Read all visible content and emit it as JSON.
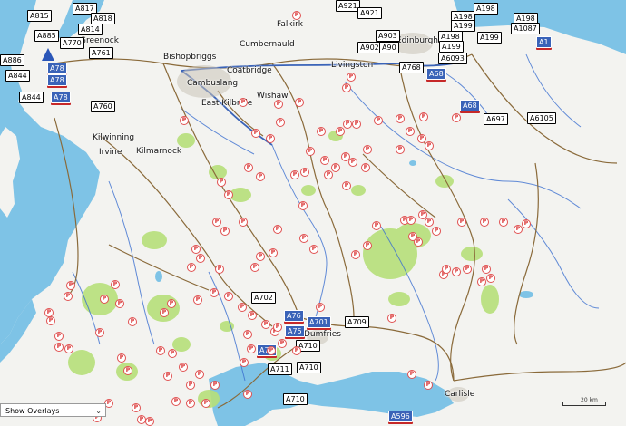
{
  "map": {
    "colors": {
      "sea": "#7ec3e6",
      "land": "#f3f3f0",
      "forest": "#b7e07a",
      "road": "#8a6a3a",
      "motorway": "#3a63b8",
      "river": "#3b6fd0",
      "parking": "#e05050"
    },
    "places": [
      {
        "id": "falkirk",
        "name": "Falkirk"
      },
      {
        "id": "cumbernauld",
        "name": "Cumbernauld"
      },
      {
        "id": "edinburgh",
        "name": "Edinburgh"
      },
      {
        "id": "bishopbriggs",
        "name": "Bishopbriggs"
      },
      {
        "id": "coatbridge",
        "name": "Coatbridge"
      },
      {
        "id": "livingston",
        "name": "Livingston"
      },
      {
        "id": "cambuslang",
        "name": "Cambuslang"
      },
      {
        "id": "wishaw",
        "name": "Wishaw"
      },
      {
        "id": "east-kilbride",
        "name": "East Kilbride"
      },
      {
        "id": "greenock",
        "name": "Greenock"
      },
      {
        "id": "kilwinning",
        "name": "Kilwinning"
      },
      {
        "id": "irvine",
        "name": "Irvine"
      },
      {
        "id": "kilmarnock",
        "name": "Kilmarnock"
      },
      {
        "id": "dumfries",
        "name": "Dumfries"
      },
      {
        "id": "carlisle",
        "name": "Carlisle"
      }
    ],
    "roads": [
      {
        "id": "a815",
        "label": "A815",
        "kind": "a"
      },
      {
        "id": "a817",
        "label": "A817",
        "kind": "a"
      },
      {
        "id": "a818",
        "label": "A818",
        "kind": "a"
      },
      {
        "id": "a885",
        "label": "A885",
        "kind": "a"
      },
      {
        "id": "a814",
        "label": "A814",
        "kind": "a"
      },
      {
        "id": "a770",
        "label": "A770",
        "kind": "a"
      },
      {
        "id": "a761",
        "label": "A761",
        "kind": "a"
      },
      {
        "id": "a886",
        "label": "A886",
        "kind": "a"
      },
      {
        "id": "a844a",
        "label": "A844",
        "kind": "a"
      },
      {
        "id": "a844b",
        "label": "A844",
        "kind": "a"
      },
      {
        "id": "a78a",
        "label": "A78",
        "kind": "m"
      },
      {
        "id": "a78b",
        "label": "A78",
        "kind": "m"
      },
      {
        "id": "a78c",
        "label": "A78",
        "kind": "m"
      },
      {
        "id": "a760",
        "label": "A760",
        "kind": "a"
      },
      {
        "id": "a921a",
        "label": "A921",
        "kind": "a"
      },
      {
        "id": "a921b",
        "label": "A921",
        "kind": "a"
      },
      {
        "id": "a903",
        "label": "A903",
        "kind": "a"
      },
      {
        "id": "a902",
        "label": "A902",
        "kind": "a"
      },
      {
        "id": "a90",
        "label": "A90",
        "kind": "a"
      },
      {
        "id": "a768",
        "label": "A768",
        "kind": "a"
      },
      {
        "id": "a68a",
        "label": "A68",
        "kind": "m"
      },
      {
        "id": "a68b",
        "label": "A68",
        "kind": "m"
      },
      {
        "id": "a6093",
        "label": "A6093",
        "kind": "a"
      },
      {
        "id": "a198a",
        "label": "A198",
        "kind": "a"
      },
      {
        "id": "a198b",
        "label": "A198",
        "kind": "a"
      },
      {
        "id": "a198c",
        "label": "A198",
        "kind": "a"
      },
      {
        "id": "a198d",
        "label": "A198",
        "kind": "a"
      },
      {
        "id": "a199a",
        "label": "A199",
        "kind": "a"
      },
      {
        "id": "a199b",
        "label": "A199",
        "kind": "a"
      },
      {
        "id": "a199c",
        "label": "A199",
        "kind": "a"
      },
      {
        "id": "a1087",
        "label": "A1087",
        "kind": "a"
      },
      {
        "id": "a1",
        "label": "A1",
        "kind": "m"
      },
      {
        "id": "a697",
        "label": "A697",
        "kind": "a"
      },
      {
        "id": "a6105",
        "label": "A6105",
        "kind": "a"
      },
      {
        "id": "a702",
        "label": "A702",
        "kind": "a"
      },
      {
        "id": "a76",
        "label": "A76",
        "kind": "m"
      },
      {
        "id": "a701",
        "label": "A701",
        "kind": "m"
      },
      {
        "id": "a709",
        "label": "A709",
        "kind": "a"
      },
      {
        "id": "a75a",
        "label": "A75",
        "kind": "m"
      },
      {
        "id": "a75b",
        "label": "A75",
        "kind": "m"
      },
      {
        "id": "a710a",
        "label": "A710",
        "kind": "a"
      },
      {
        "id": "a710b",
        "label": "A710",
        "kind": "a"
      },
      {
        "id": "a710c",
        "label": "A710",
        "kind": "a"
      },
      {
        "id": "a711",
        "label": "A711",
        "kind": "a"
      },
      {
        "id": "a596",
        "label": "A596",
        "kind": "m"
      }
    ],
    "parking_symbol": "P",
    "scale_label": "20 km",
    "marker_icon": "location-arrow-icon"
  },
  "controls": {
    "overlays_label": "Show Overlays",
    "overlays_chevron": "⌄"
  }
}
